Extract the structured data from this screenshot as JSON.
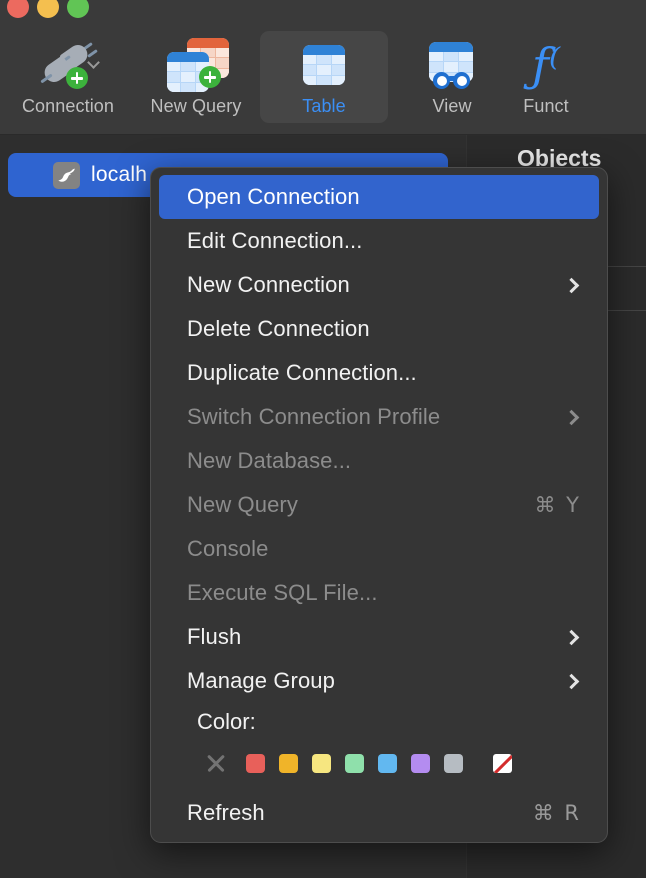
{
  "window": {
    "traffic_lights": [
      {
        "name": "close",
        "color": "#ec6a5f"
      },
      {
        "name": "minimize",
        "color": "#f4bf4f"
      },
      {
        "name": "zoom",
        "color": "#61c555"
      }
    ]
  },
  "toolbar": {
    "items": [
      {
        "label": "Connection",
        "icon": "connection-plug-icon",
        "selected": false,
        "has_dropdown": true
      },
      {
        "label": "New Query",
        "icon": "new-query-icon",
        "selected": false,
        "has_dropdown": false
      },
      {
        "label": "Table",
        "icon": "table-icon",
        "selected": true,
        "has_dropdown": false
      },
      {
        "label": "View",
        "icon": "view-icon",
        "selected": false,
        "has_dropdown": false
      },
      {
        "label": "Funct",
        "icon": "function-icon",
        "selected": false,
        "has_dropdown": false
      }
    ],
    "selected_label_color": "#3b8ff5"
  },
  "sidebar": {
    "connection": {
      "label": "localh",
      "icon": "mariadb-seal-icon",
      "selected": true,
      "highlight_color": "#2f64d0"
    }
  },
  "right_panel": {
    "title": "Objects"
  },
  "context_menu": {
    "highlight_color": "#3264cd",
    "items": [
      {
        "label": "Open Connection",
        "state": "highlighted",
        "shortcut": "",
        "submenu": false
      },
      {
        "label": "Edit Connection...",
        "state": "enabled",
        "shortcut": "",
        "submenu": false
      },
      {
        "label": "New Connection",
        "state": "enabled",
        "shortcut": "",
        "submenu": true
      },
      {
        "label": "Delete Connection",
        "state": "enabled",
        "shortcut": "",
        "submenu": false
      },
      {
        "label": "Duplicate Connection...",
        "state": "enabled",
        "shortcut": "",
        "submenu": false
      },
      {
        "label": "Switch Connection Profile",
        "state": "disabled",
        "shortcut": "",
        "submenu": true
      },
      {
        "label": "New Database...",
        "state": "disabled",
        "shortcut": "",
        "submenu": false
      },
      {
        "label": "New Query",
        "state": "disabled",
        "shortcut": "⌘ Y",
        "submenu": false
      },
      {
        "label": "Console",
        "state": "disabled",
        "shortcut": "",
        "submenu": false
      },
      {
        "label": "Execute SQL File...",
        "state": "disabled",
        "shortcut": "",
        "submenu": false
      },
      {
        "label": "Flush",
        "state": "enabled",
        "shortcut": "",
        "submenu": true
      },
      {
        "label": "Manage Group",
        "state": "enabled",
        "shortcut": "",
        "submenu": true
      }
    ],
    "color_section": {
      "label": "Color:",
      "swatches": [
        {
          "name": "no-color",
          "color": "none"
        },
        {
          "name": "red",
          "color": "#e8605a"
        },
        {
          "name": "orange",
          "color": "#f0b429"
        },
        {
          "name": "yellow",
          "color": "#f6e680"
        },
        {
          "name": "green",
          "color": "#8fe0ab"
        },
        {
          "name": "blue",
          "color": "#62b8f0"
        },
        {
          "name": "purple",
          "color": "#b48cf0"
        },
        {
          "name": "gray",
          "color": "#b6bcc2"
        },
        {
          "name": "custom",
          "color": "#ffffff"
        }
      ]
    },
    "footer_item": {
      "label": "Refresh",
      "shortcut": "⌘ R",
      "state": "enabled"
    }
  }
}
